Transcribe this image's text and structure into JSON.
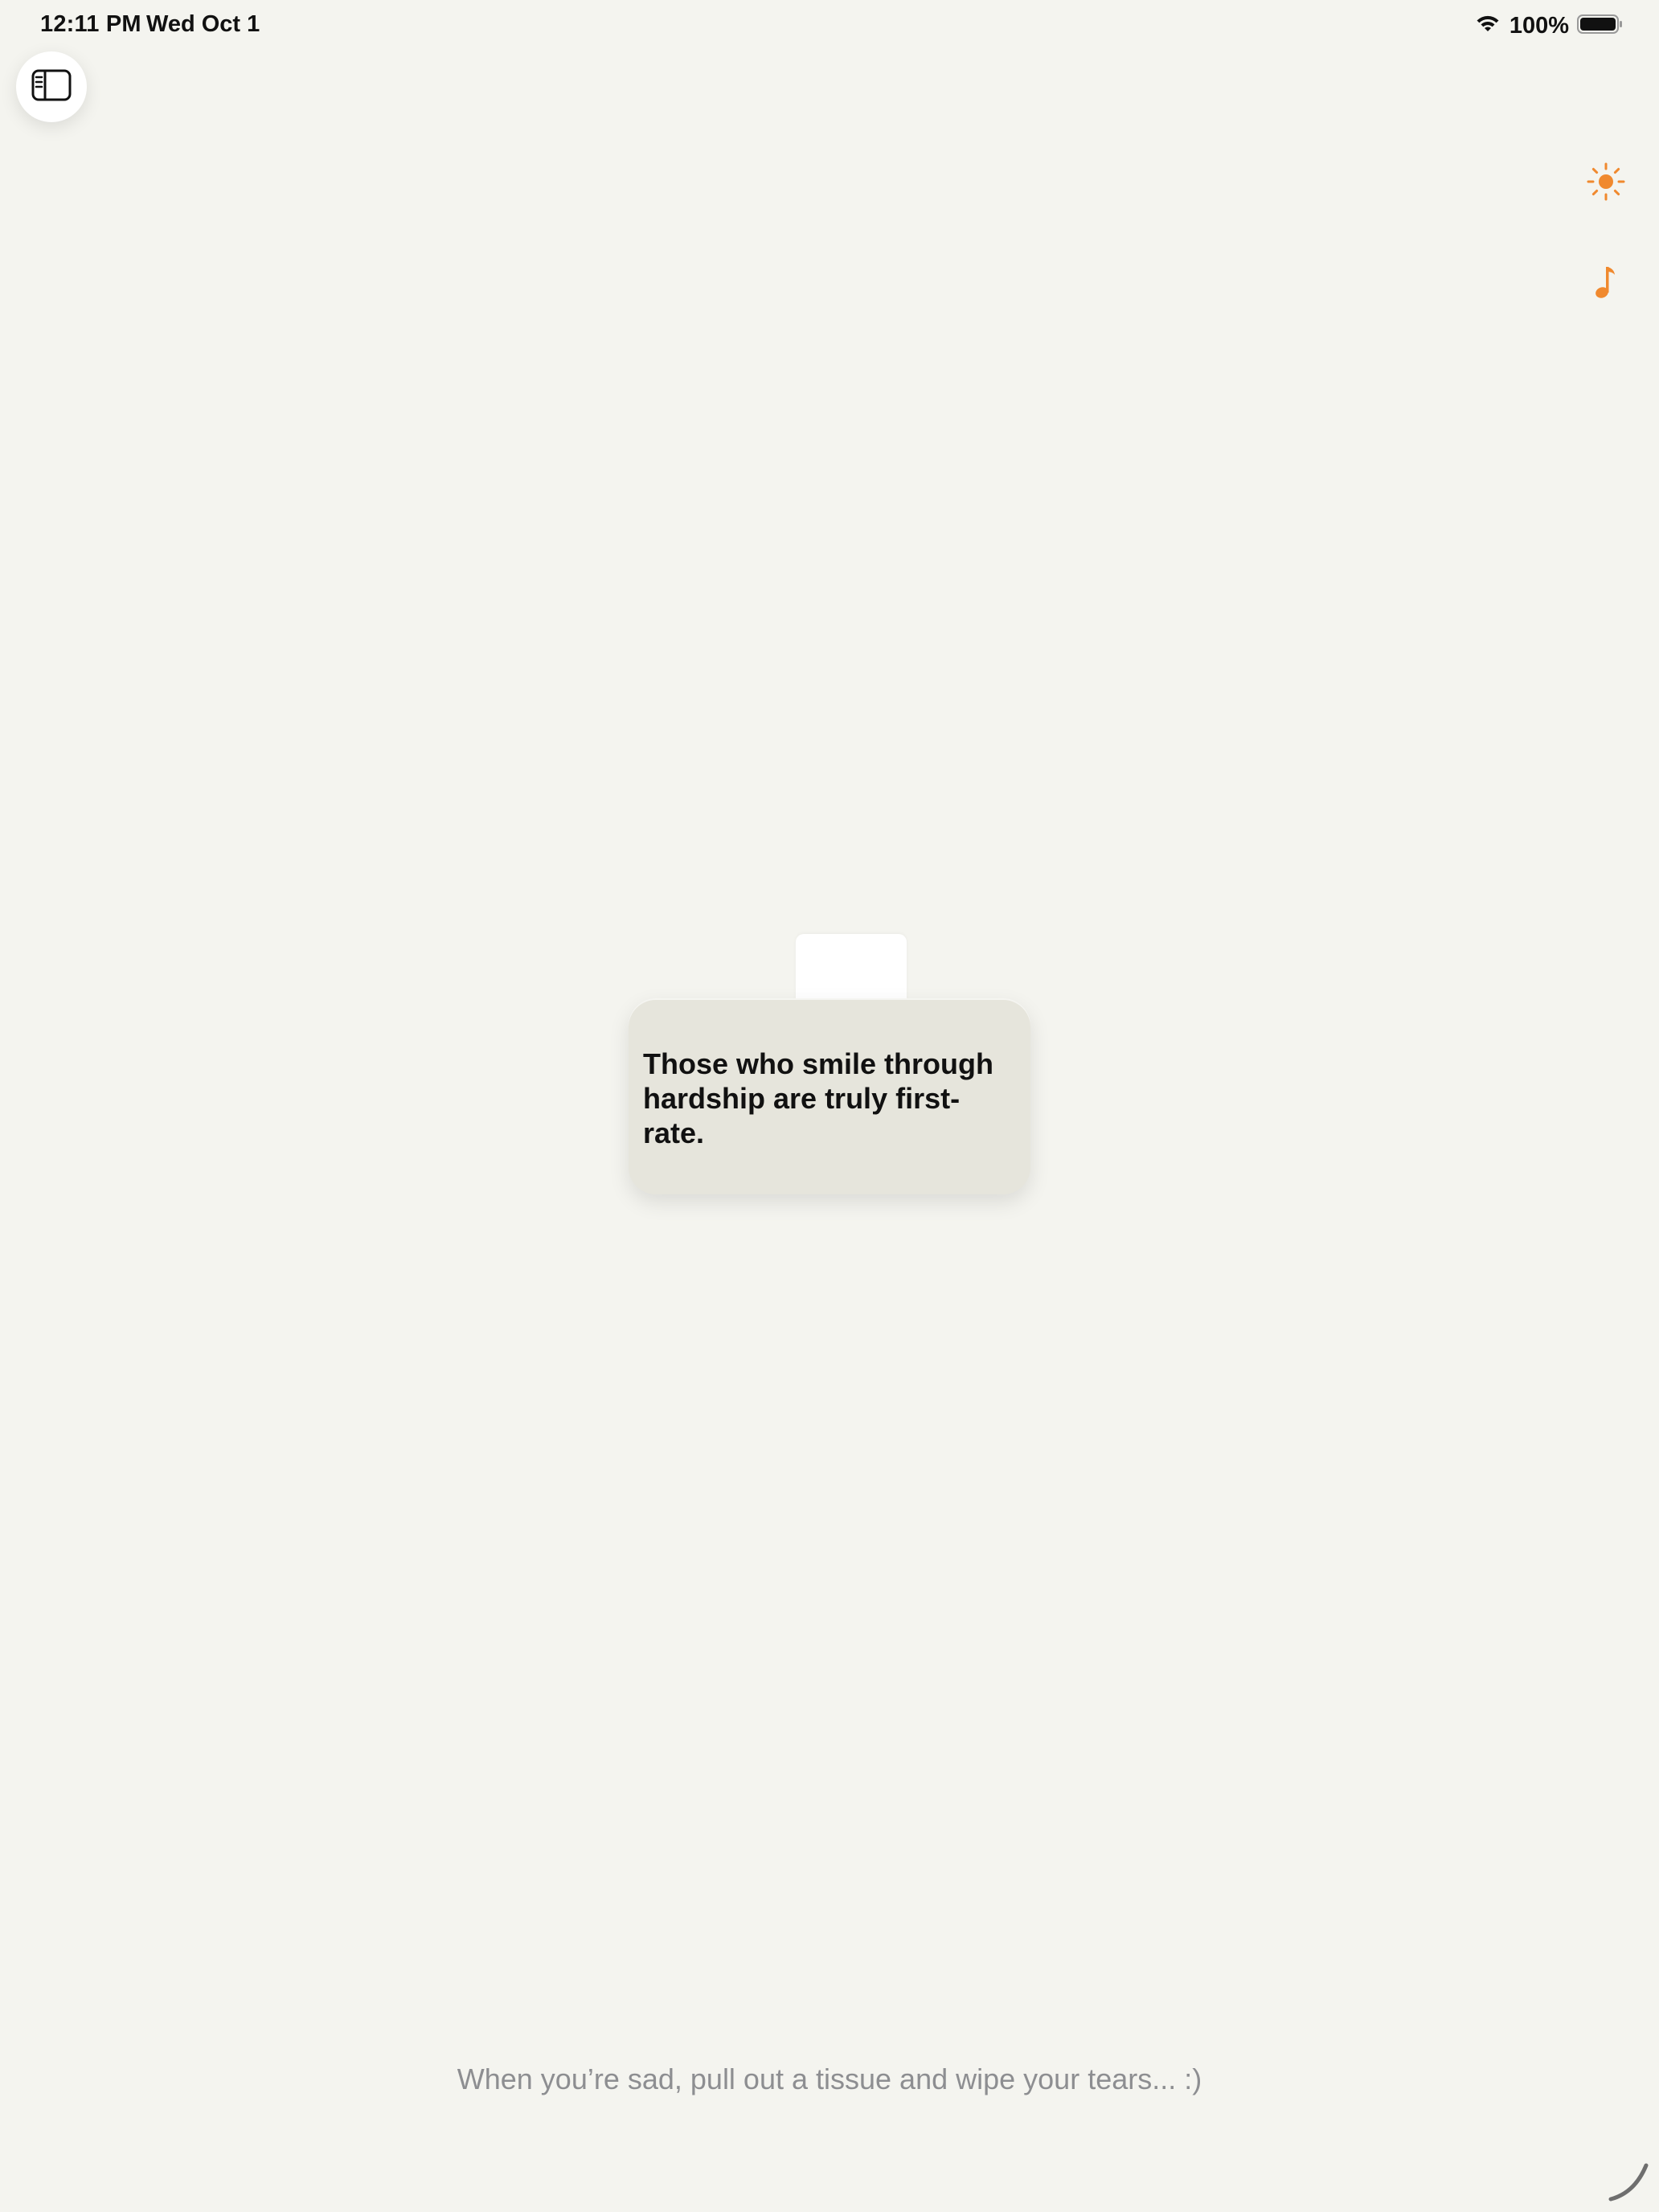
{
  "status_bar": {
    "time": "12:11 PM",
    "date": "Wed Oct 1",
    "battery_percent": "100%",
    "wifi_icon": "wifi-icon",
    "battery_icon": "battery-full-icon"
  },
  "toolbar": {
    "sidebar_icon": "sidebar-toggle-icon",
    "sun_icon": "sun-icon",
    "music_icon": "music-note-icon",
    "accent_color": "#f0892e"
  },
  "tissue": {
    "quote": "Those who smile through hardship are truly first-rate.",
    "box_color": "#e6e5dc",
    "sheet_color": "#ffffff"
  },
  "hint": {
    "text": "When you’re sad, pull out a tissue and wipe your tears... :)"
  },
  "colors": {
    "background": "#f4f4ef",
    "hint_text": "#8d8e91"
  }
}
